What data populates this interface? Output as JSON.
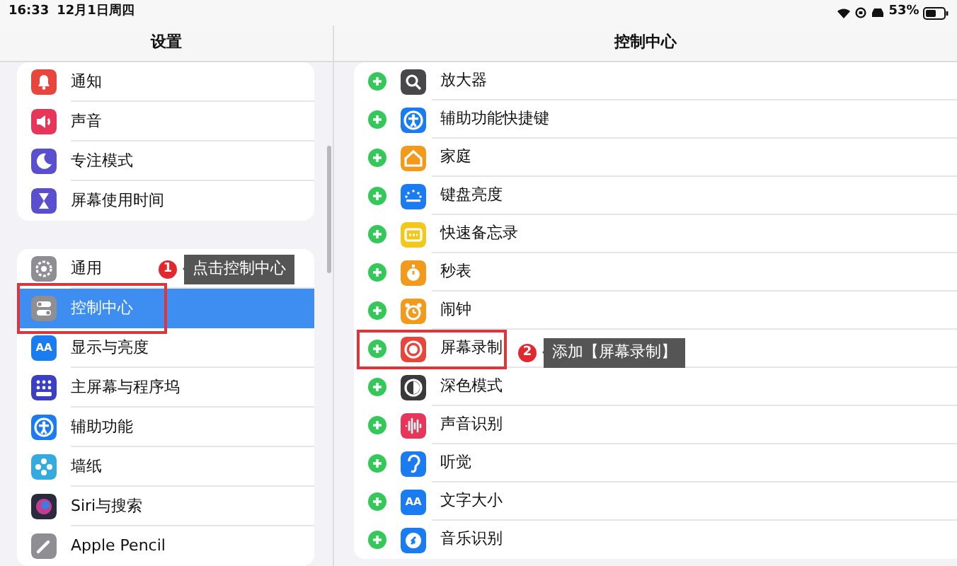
{
  "status_bar": {
    "time": "16:33",
    "date": "12月1日周四",
    "battery": "53%"
  },
  "settings": {
    "title": "设置",
    "groups": [
      [
        {
          "label": "通知",
          "color": "#e8453c",
          "selected": false,
          "highlighted": false
        },
        {
          "label": "声音",
          "color": "#e8365a",
          "selected": false,
          "highlighted": false
        },
        {
          "label": "专注模式",
          "color": "#5a4fcf",
          "selected": false,
          "highlighted": false
        },
        {
          "label": "屏幕使用时间",
          "color": "#5a4fcf",
          "selected": false,
          "highlighted": false
        }
      ],
      [
        {
          "label": "通用",
          "color": "#8e8e93",
          "selected": false,
          "highlighted": false
        },
        {
          "label": "控制中心",
          "color": "#8e8e93",
          "selected": true,
          "highlighted": true,
          "callout": {
            "number": "1",
            "text": "点击控制中心"
          }
        },
        {
          "label": "显示与亮度",
          "color": "#1a7cf0",
          "icon_text": "AA",
          "selected": false,
          "highlighted": false
        },
        {
          "label": "主屏幕与程序坞",
          "color": "#3a3fc4",
          "selected": false,
          "highlighted": false
        },
        {
          "label": "辅助功能",
          "color": "#1a7cf0",
          "selected": false,
          "highlighted": false
        },
        {
          "label": "墙纸",
          "color": "#35aadc",
          "selected": false,
          "highlighted": false
        },
        {
          "label": "Siri与搜索",
          "color": "#2b2b40",
          "selected": false,
          "highlighted": false
        },
        {
          "label": "Apple Pencil",
          "color": "#8e8e93",
          "selected": false,
          "highlighted": false
        }
      ]
    ]
  },
  "control_center": {
    "title": "控制中心",
    "controls": [
      {
        "label": "放大器",
        "color": "#48484a",
        "highlighted": false
      },
      {
        "label": "辅助功能快捷键",
        "color": "#1a7cf0",
        "highlighted": false
      },
      {
        "label": "家庭",
        "color": "#f29a1c",
        "highlighted": false
      },
      {
        "label": "键盘亮度",
        "color": "#1a7cf0",
        "highlighted": false
      },
      {
        "label": "快速备忘录",
        "color": "#f2c81c",
        "highlighted": false
      },
      {
        "label": "秒表",
        "color": "#f29a1c",
        "highlighted": false
      },
      {
        "label": "闹钟",
        "color": "#f29a1c",
        "highlighted": false
      },
      {
        "label": "屏幕录制",
        "color": "#e8453c",
        "highlighted": true,
        "callout": {
          "number": "2",
          "text": "添加【屏幕录制】"
        }
      },
      {
        "label": "深色模式",
        "color": "#3a3a3c",
        "highlighted": false
      },
      {
        "label": "声音识别",
        "color": "#e8365a",
        "highlighted": false
      },
      {
        "label": "听觉",
        "color": "#1a7cf0",
        "highlighted": false
      },
      {
        "label": "文字大小",
        "color": "#1a7cf0",
        "icon_text": "AA",
        "highlighted": false
      },
      {
        "label": "音乐识别",
        "color": "#1a7cf0",
        "highlighted": false
      }
    ]
  }
}
